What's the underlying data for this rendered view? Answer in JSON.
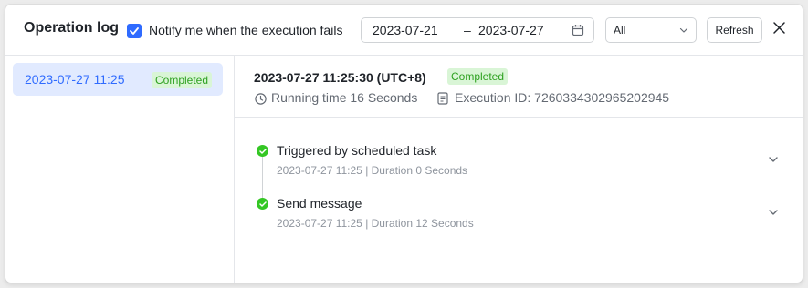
{
  "header": {
    "title": "Operation log",
    "notify": {
      "checked": true,
      "label": "Notify me when the execution fails"
    },
    "date_range": {
      "start": "2023-07-21",
      "separator": "–",
      "end": "2023-07-27"
    },
    "filter": {
      "value": "All"
    },
    "refresh_label": "Refresh"
  },
  "sidebar": {
    "items": [
      {
        "time": "2023-07-27 11:25",
        "status": "Completed",
        "selected": true
      }
    ]
  },
  "detail": {
    "run_time": "2023-07-27 11:25:30 (UTC+8)",
    "status": "Completed",
    "running_time": "Running time 16 Seconds",
    "execution_id": "Execution ID: 7260334302965202945",
    "steps": [
      {
        "title": "Triggered by scheduled task",
        "subtitle": "2023-07-27 11:25 | Duration 0 Seconds"
      },
      {
        "title": "Send message",
        "subtitle": "2023-07-27 11:25 | Duration 12 Seconds"
      }
    ]
  },
  "colors": {
    "accent": "#2f6bff",
    "selected_bg": "#e1eaff",
    "success": "#34c724",
    "badge_bg": "#d9f5d6",
    "badge_text": "#2ea121"
  },
  "icons": [
    "check-icon",
    "calendar-icon",
    "chevron-down-icon",
    "close-icon",
    "clock-icon",
    "document-icon"
  ]
}
